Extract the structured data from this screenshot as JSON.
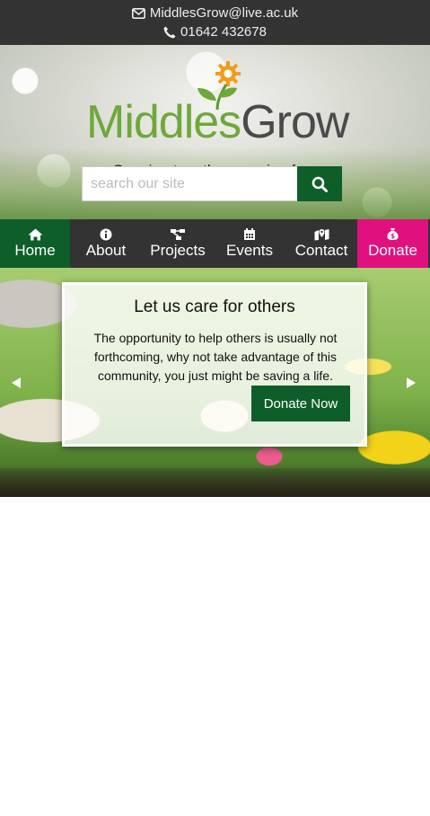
{
  "topbar": {
    "email": "MiddlesGrow@live.ac.uk",
    "phone": "01642 432678"
  },
  "header": {
    "logo_part1": "Middles",
    "logo_part2": "Grow",
    "tagline": "Growing together growing forever",
    "search_placeholder": "search our site"
  },
  "nav": {
    "items": [
      {
        "label": "Home",
        "icon": "home-icon"
      },
      {
        "label": "About",
        "icon": "info-icon"
      },
      {
        "label": "Projects",
        "icon": "sitemap-icon"
      },
      {
        "label": "Events",
        "icon": "calendar-icon"
      },
      {
        "label": "Contact",
        "icon": "map-marker-icon"
      },
      {
        "label": "Donate",
        "icon": "money-bag-icon"
      }
    ]
  },
  "slider": {
    "title": "Let us care for others",
    "text": "The opportunity to help others is usually not forthcoming, why not take advantage of this community, you just might be saving a life.",
    "button_label": "Donate Now"
  },
  "colors": {
    "dark_bar": "#333333",
    "brand_green": "#0e5e2a",
    "logo_green": "#6fa83a",
    "donate_pink": "#e0117e"
  }
}
